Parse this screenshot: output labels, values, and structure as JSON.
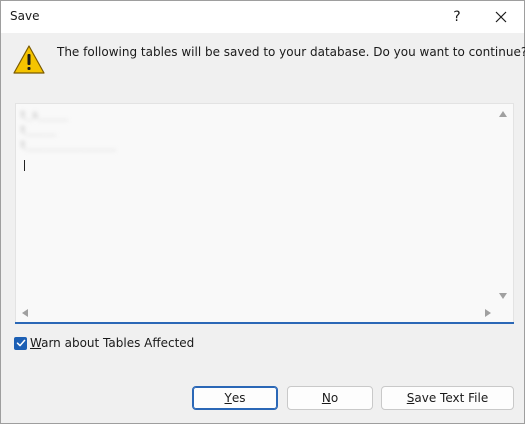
{
  "window": {
    "title": "Save",
    "help_glyph": "?",
    "close_glyph": "✕"
  },
  "message": "The following tables will be saved to your database. Do you want to continue?",
  "textbox": {
    "lines": [
      "t_s_____",
      "t_____",
      "t_______________"
    ]
  },
  "checkbox": {
    "checked": true,
    "label_accel": "W",
    "label_rest": "arn about Tables Affected"
  },
  "buttons": {
    "yes": {
      "accel": "Y",
      "rest": "es"
    },
    "no": {
      "accel": "N",
      "rest": "o"
    },
    "save_text_file": {
      "prefix": "",
      "accel": "S",
      "rest": "ave Text File"
    }
  },
  "icons": {
    "warning": "warning-icon",
    "close": "close-icon",
    "help": "help-icon",
    "check": "check-icon"
  },
  "colors": {
    "accent": "#2a67b6",
    "warning_fill": "#f5c400"
  }
}
